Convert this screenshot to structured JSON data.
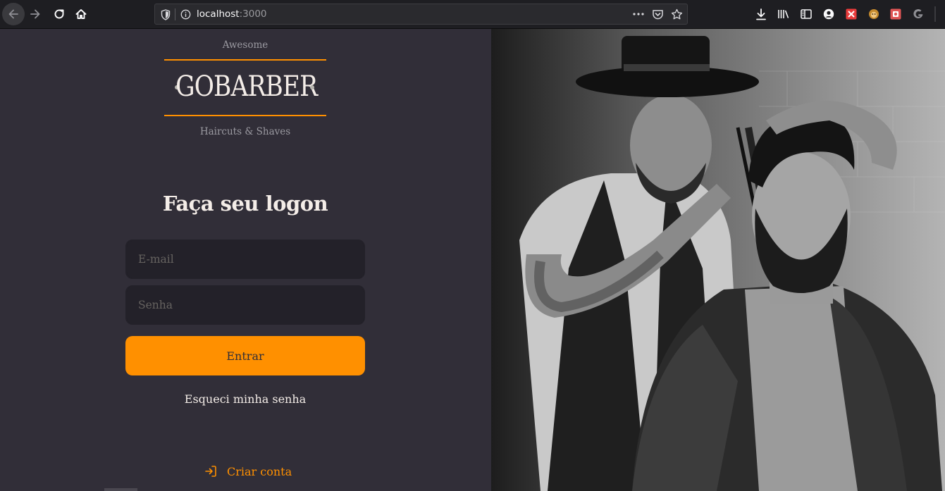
{
  "browser": {
    "url_host": "localhost",
    "url_port": ":3000",
    "icons": {
      "back": "back-arrow-icon",
      "forward": "forward-arrow-icon",
      "reload": "reload-icon",
      "home": "home-icon",
      "shield": "tracking-shield-icon",
      "info": "site-info-icon",
      "more": "more-actions-icon",
      "pocket": "pocket-icon",
      "star": "bookmark-star-icon",
      "download": "download-icon",
      "library": "library-icon",
      "sidebar": "sidebar-icon",
      "account": "account-icon",
      "ext1": "extension-red-icon",
      "ext2": "extension-monkey-icon",
      "ext3": "extension-red-square-icon",
      "ext4": "extension-g-icon"
    }
  },
  "logo": {
    "top_text": "Awesome",
    "wordmark": "GOBARBER",
    "bottom_text": "Haircuts & Shaves"
  },
  "form": {
    "title": "Faça seu logon",
    "email_placeholder": "E-mail",
    "password_placeholder": "Senha",
    "submit_label": "Entrar",
    "forgot_label": "Esqueci minha senha"
  },
  "footer": {
    "create_account_label": "Criar conta"
  },
  "colors": {
    "background": "#312e38",
    "input_bg": "#232129",
    "accent": "#ff9000",
    "text": "#f4ede8",
    "placeholder": "#666360"
  }
}
